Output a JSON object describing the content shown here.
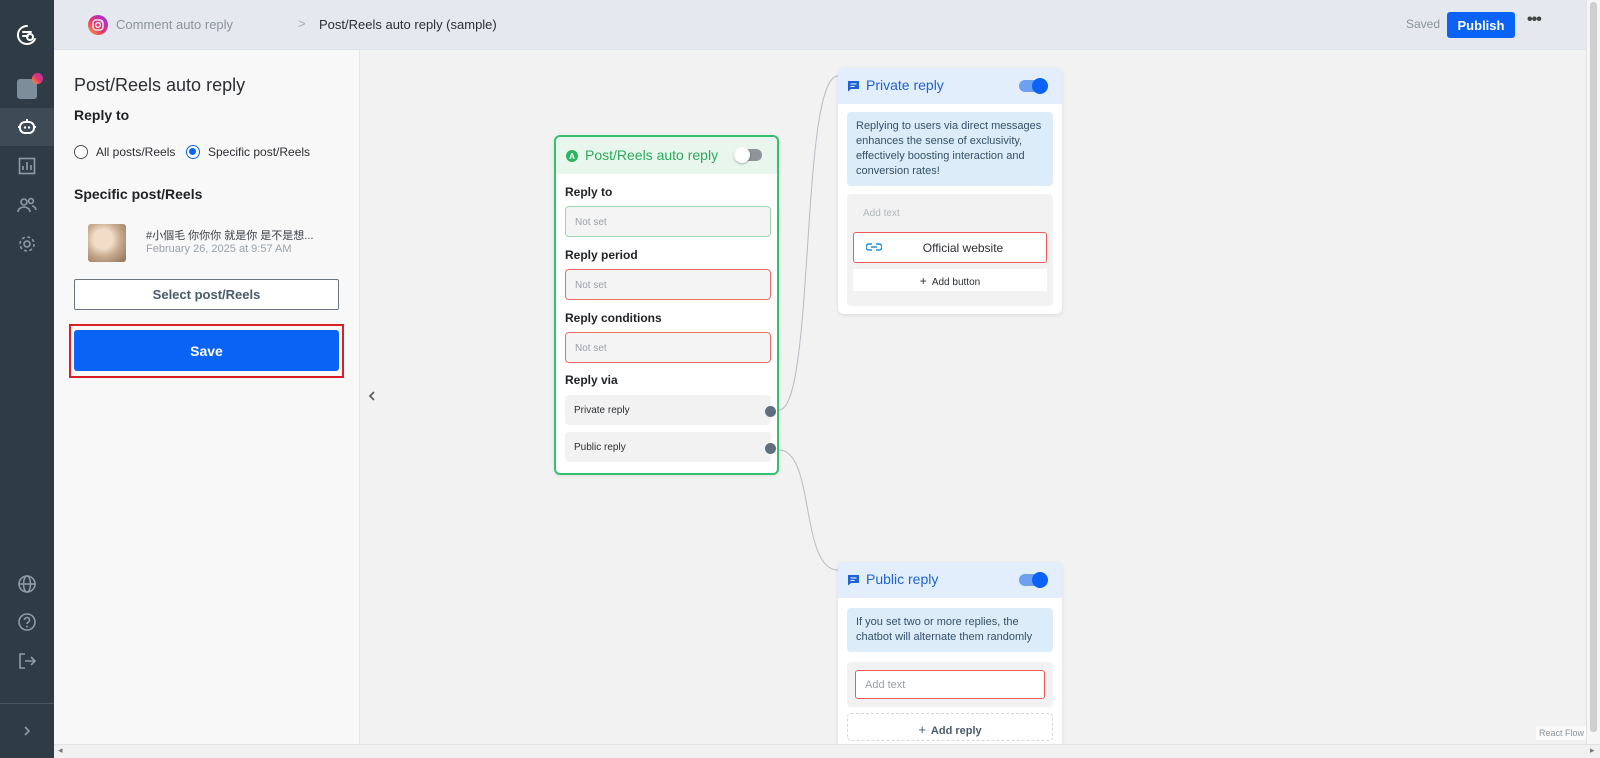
{
  "header": {
    "breadcrumb_parent": "Comment auto reply",
    "breadcrumb_separator": ">",
    "breadcrumb_current": "Post/Reels auto reply (sample)",
    "saved_status": "Saved",
    "publish_label": "Publish",
    "more_label": "•••"
  },
  "nav": {
    "items": [
      "app-logo",
      "inbox",
      "chatbot",
      "analytics",
      "contacts",
      "settings",
      "language",
      "help",
      "logout",
      "expand"
    ],
    "active": "chatbot"
  },
  "panel": {
    "title": "Post/Reels auto reply",
    "reply_to_label": "Reply to",
    "options": [
      "All posts/Reels",
      "Specific post/Reels"
    ],
    "selected_option": "Specific post/Reels",
    "specific_label": "Specific post/Reels",
    "post_caption": "#小個毛 你你你 就是你 是不是想...",
    "post_date": "February 26, 2025 at 9:57 AM",
    "select_button": "Select post/Reels",
    "save_button": "Save"
  },
  "trigger_node": {
    "title": "Post/Reels auto reply",
    "badge": "A",
    "enabled": false,
    "fields": [
      {
        "label": "Reply to",
        "value": "Not set"
      },
      {
        "label": "Reply period",
        "value": "Not set"
      },
      {
        "label": "Reply conditions",
        "value": "Not set"
      }
    ],
    "reply_via_label": "Reply via",
    "reply_via": [
      "Private reply",
      "Public reply"
    ]
  },
  "private_reply": {
    "title": "Private reply",
    "enabled": true,
    "info": "Replying to users via direct messages enhances the sense of exclusivity, effectively boosting interaction and conversion rates!",
    "add_text_placeholder": "Add text",
    "button_label": "Official website",
    "add_button": "Add button"
  },
  "public_reply": {
    "title": "Public reply",
    "enabled": true,
    "info": "If you set two or more replies, the chatbot will alternate them randomly",
    "add_text_placeholder": "Add text",
    "add_reply": "Add reply"
  },
  "footer": {
    "react_flow": "React Flow"
  },
  "colors": {
    "primary": "#0b63f6",
    "nav_bg": "#2f3b45",
    "trigger_green": "#34c06c",
    "error_red": "#ef5a5a",
    "highlight_red": "#d91f26"
  }
}
